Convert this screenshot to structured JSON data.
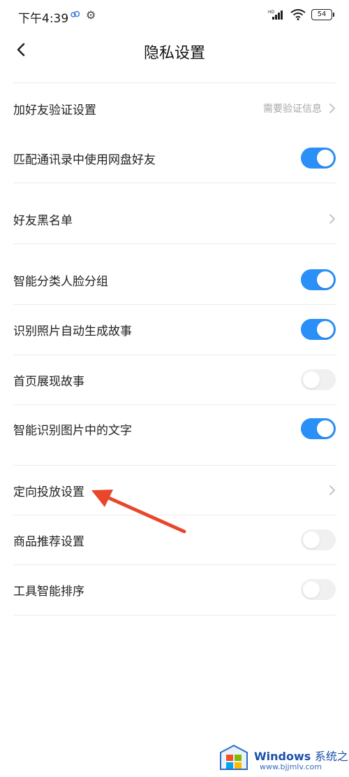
{
  "status_bar": {
    "time": "下午4:39",
    "battery": "54",
    "signal_label": "HD"
  },
  "header": {
    "title": "隐私设置"
  },
  "rows": [
    {
      "label": "加好友验证设置",
      "value": "需要验证信息",
      "control": "chevron"
    },
    {
      "label": "匹配通讯录中使用网盘好友",
      "control": "toggle",
      "on": true
    },
    {
      "label": "好友黑名单",
      "control": "chevron"
    },
    {
      "label": "智能分类人脸分组",
      "control": "toggle",
      "on": true
    },
    {
      "label": "识别照片自动生成故事",
      "control": "toggle",
      "on": true
    },
    {
      "label": "首页展现故事",
      "control": "toggle",
      "on": false
    },
    {
      "label": "智能识别图片中的文字",
      "control": "toggle",
      "on": true
    },
    {
      "label": "定向投放设置",
      "control": "chevron"
    },
    {
      "label": "商品推荐设置",
      "control": "toggle",
      "on": false
    },
    {
      "label": "工具智能排序",
      "control": "toggle",
      "on": false
    }
  ],
  "watermark": {
    "title": "Windows",
    "title_cn": "系统之家",
    "url": "www.bjjmlv.com"
  },
  "colors": {
    "toggle_on": "#2a8ff7",
    "toggle_off": "#f0f0f0",
    "annotation_arrow": "#e8472c"
  }
}
